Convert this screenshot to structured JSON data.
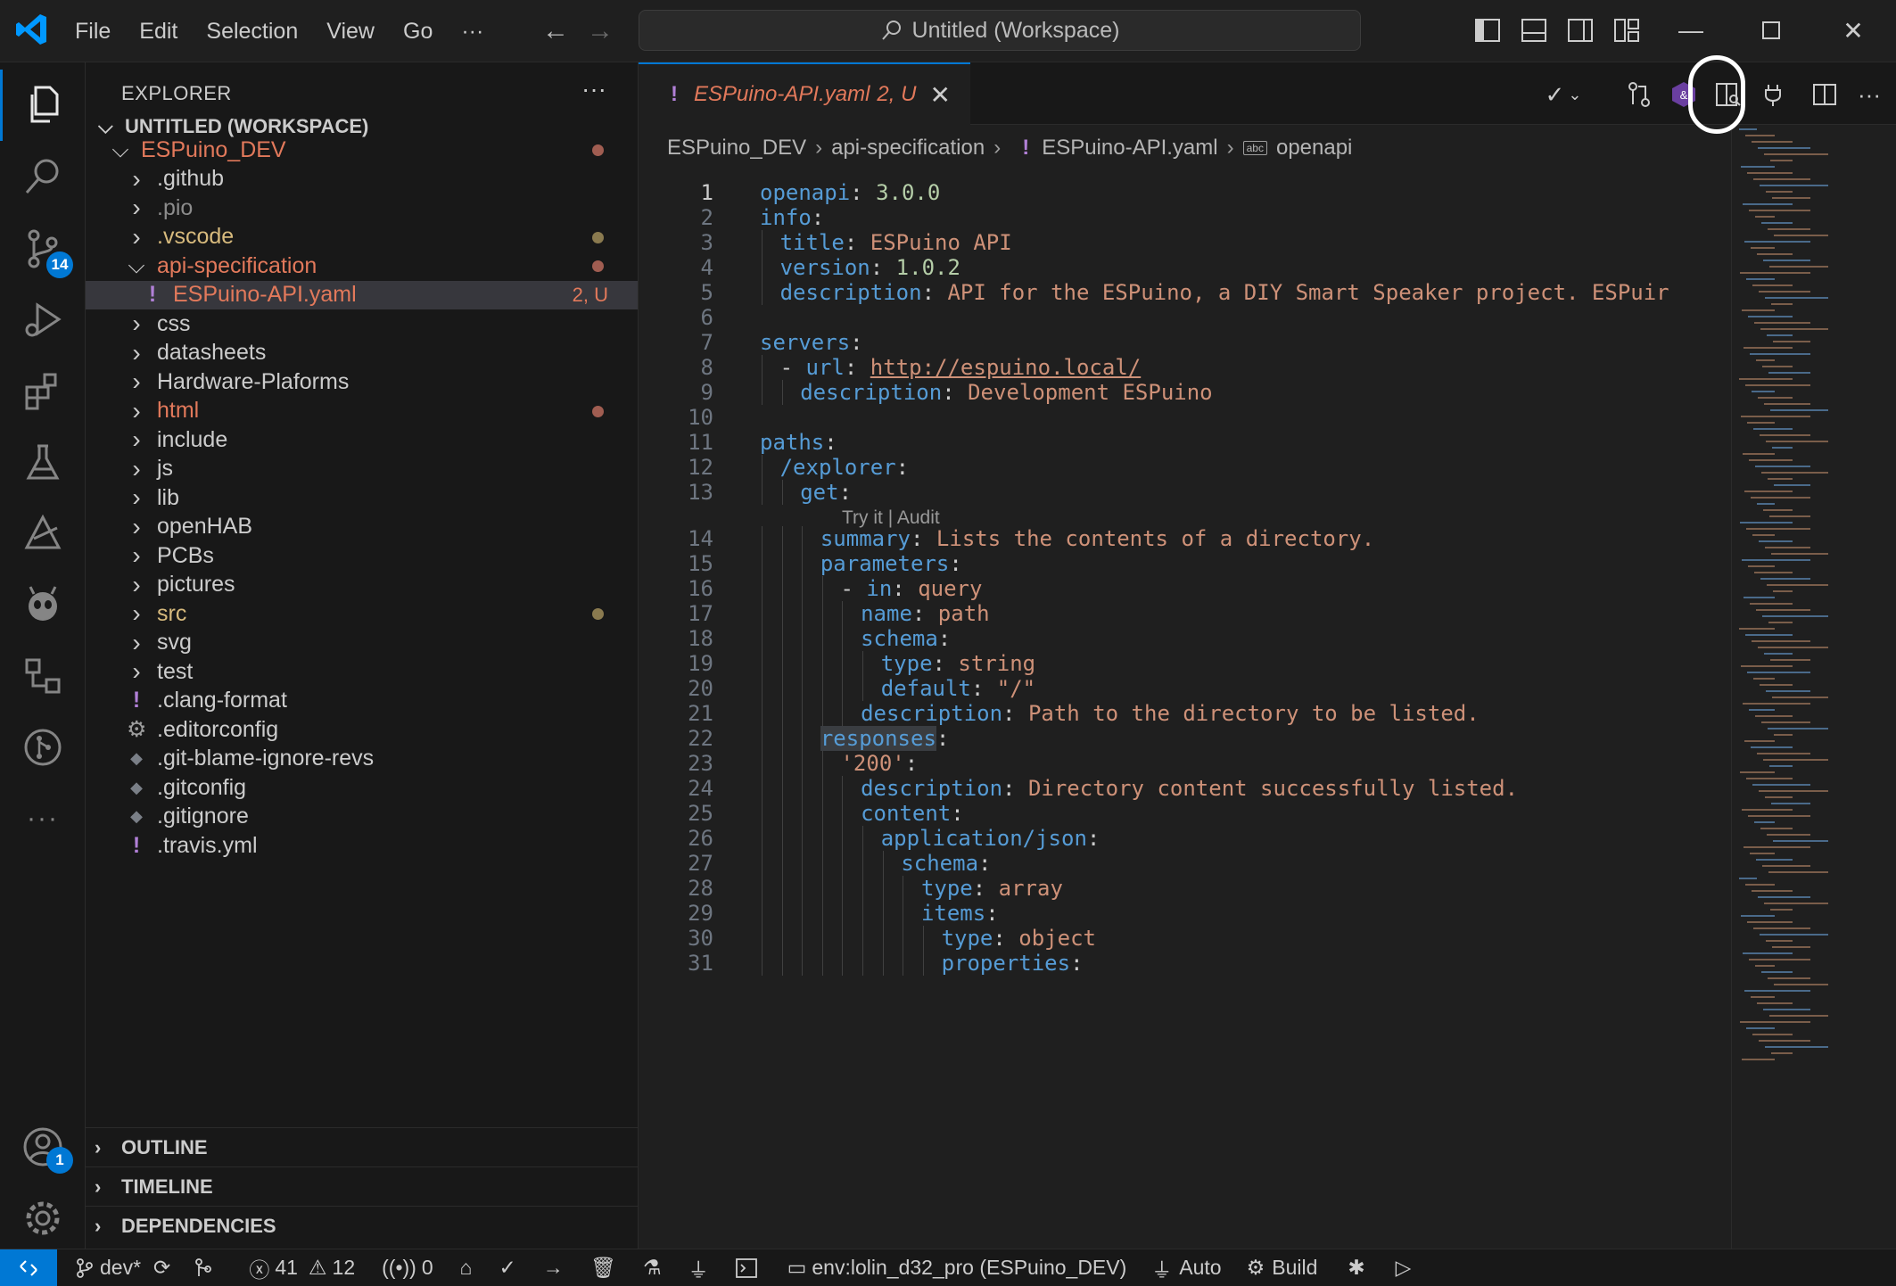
{
  "titlebar": {
    "menu": [
      "File",
      "Edit",
      "Selection",
      "View",
      "Go",
      "···"
    ],
    "search": "Untitled (Workspace)"
  },
  "activity": {
    "scm_badge": "14",
    "accounts_badge": "1"
  },
  "explorer": {
    "title": "EXPLORER",
    "workspace": "UNTITLED (WORKSPACE)",
    "items": [
      {
        "label": "ESPuino_DEV",
        "type": "folder-open",
        "color": "#e2795b",
        "dot": "#a05d51"
      },
      {
        "label": ".github",
        "type": "folder"
      },
      {
        "label": ".pio",
        "type": "folder",
        "color": "#8c8c8c"
      },
      {
        "label": ".vscode",
        "type": "folder",
        "color": "#d7ba7d",
        "dot": "#8a7a4f"
      },
      {
        "label": "api-specification",
        "type": "folder-open",
        "color": "#e2795b",
        "dot": "#a05d51"
      },
      {
        "label": "ESPuino-API.yaml",
        "type": "file-yaml",
        "color": "#e2795b",
        "status": "2, U"
      },
      {
        "label": "css",
        "type": "folder"
      },
      {
        "label": "datasheets",
        "type": "folder"
      },
      {
        "label": "Hardware-Plaforms",
        "type": "folder"
      },
      {
        "label": "html",
        "type": "folder",
        "color": "#e2795b",
        "dot": "#a05d51"
      },
      {
        "label": "include",
        "type": "folder"
      },
      {
        "label": "js",
        "type": "folder"
      },
      {
        "label": "lib",
        "type": "folder"
      },
      {
        "label": "openHAB",
        "type": "folder"
      },
      {
        "label": "PCBs",
        "type": "folder"
      },
      {
        "label": "pictures",
        "type": "folder"
      },
      {
        "label": "src",
        "type": "folder",
        "color": "#d7ba7d",
        "dot": "#8a7a4f"
      },
      {
        "label": "svg",
        "type": "folder"
      },
      {
        "label": "test",
        "type": "folder"
      },
      {
        "label": ".clang-format",
        "type": "file-bang"
      },
      {
        "label": ".editorconfig",
        "type": "file-gear"
      },
      {
        "label": ".git-blame-ignore-revs",
        "type": "file-git"
      },
      {
        "label": ".gitconfig",
        "type": "file-git"
      },
      {
        "label": ".gitignore",
        "type": "file-git"
      },
      {
        "label": ".travis.yml",
        "type": "file-bang"
      }
    ],
    "panels": [
      "OUTLINE",
      "TIMELINE",
      "DEPENDENCIES"
    ]
  },
  "tab": {
    "name": "ESPuino-API.yaml",
    "status": "2, U"
  },
  "breadcrumb": [
    "ESPuino_DEV",
    "api-specification",
    "ESPuino-API.yaml",
    "openapi"
  ],
  "codelens": "Try it | Audit",
  "code": [
    {
      "n": "1",
      "i": 0,
      "t": [
        [
          "k",
          "openapi"
        ],
        [
          "p",
          ": "
        ],
        [
          "n",
          "3.0.0"
        ]
      ]
    },
    {
      "n": "2",
      "i": 0,
      "t": [
        [
          "k",
          "info"
        ],
        [
          "p",
          ":"
        ]
      ]
    },
    {
      "n": "3",
      "i": 1,
      "t": [
        [
          "k",
          "title"
        ],
        [
          "p",
          ": "
        ],
        [
          "s",
          "ESPuino API"
        ]
      ]
    },
    {
      "n": "4",
      "i": 1,
      "t": [
        [
          "k",
          "version"
        ],
        [
          "p",
          ": "
        ],
        [
          "n",
          "1.0.2"
        ]
      ]
    },
    {
      "n": "5",
      "i": 1,
      "t": [
        [
          "k",
          "description"
        ],
        [
          "p",
          ": "
        ],
        [
          "s",
          "API for the ESPuino, a DIY Smart Speaker project. ESPuir"
        ]
      ]
    },
    {
      "n": "6",
      "i": 0,
      "t": []
    },
    {
      "n": "7",
      "i": 0,
      "t": [
        [
          "k",
          "servers"
        ],
        [
          "p",
          ":"
        ]
      ]
    },
    {
      "n": "8",
      "i": 1,
      "t": [
        [
          "p",
          "- "
        ],
        [
          "k",
          "url"
        ],
        [
          "p",
          ": "
        ],
        [
          "s",
          "http://espuino.local/"
        ]
      ]
    },
    {
      "n": "9",
      "i": 2,
      "t": [
        [
          "k",
          "description"
        ],
        [
          "p",
          ": "
        ],
        [
          "s",
          "Development ESPuino"
        ]
      ]
    },
    {
      "n": "10",
      "i": 0,
      "t": []
    },
    {
      "n": "11",
      "i": 0,
      "t": [
        [
          "k",
          "paths"
        ],
        [
          "p",
          ":"
        ]
      ]
    },
    {
      "n": "12",
      "i": 1,
      "t": [
        [
          "k",
          "/explorer"
        ],
        [
          "p",
          ":"
        ]
      ]
    },
    {
      "n": "13",
      "i": 2,
      "t": [
        [
          "k",
          "get"
        ],
        [
          "p",
          ":"
        ]
      ]
    },
    {
      "n": "14",
      "i": 3,
      "t": [
        [
          "k",
          "summary"
        ],
        [
          "p",
          ": "
        ],
        [
          "s",
          "Lists the contents of a directory."
        ]
      ]
    },
    {
      "n": "15",
      "i": 3,
      "t": [
        [
          "k",
          "parameters"
        ],
        [
          "p",
          ":"
        ]
      ]
    },
    {
      "n": "16",
      "i": 4,
      "t": [
        [
          "p",
          "- "
        ],
        [
          "k",
          "in"
        ],
        [
          "p",
          ": "
        ],
        [
          "s",
          "query"
        ]
      ]
    },
    {
      "n": "17",
      "i": 5,
      "t": [
        [
          "k",
          "name"
        ],
        [
          "p",
          ": "
        ],
        [
          "s",
          "path"
        ]
      ]
    },
    {
      "n": "18",
      "i": 5,
      "t": [
        [
          "k",
          "schema"
        ],
        [
          "p",
          ":"
        ]
      ]
    },
    {
      "n": "19",
      "i": 6,
      "t": [
        [
          "k",
          "type"
        ],
        [
          "p",
          ": "
        ],
        [
          "s",
          "string"
        ]
      ]
    },
    {
      "n": "20",
      "i": 6,
      "t": [
        [
          "k",
          "default"
        ],
        [
          "p",
          ": "
        ],
        [
          "s",
          "\"/\""
        ]
      ]
    },
    {
      "n": "21",
      "i": 5,
      "t": [
        [
          "k",
          "description"
        ],
        [
          "p",
          ": "
        ],
        [
          "s",
          "Path to the directory to be listed."
        ]
      ]
    },
    {
      "n": "22",
      "i": 3,
      "t": [
        [
          "k",
          "responses"
        ],
        [
          "p",
          ":"
        ]
      ],
      "hl": true
    },
    {
      "n": "23",
      "i": 4,
      "t": [
        [
          "s",
          "'200'"
        ],
        [
          "p",
          ":"
        ]
      ]
    },
    {
      "n": "24",
      "i": 5,
      "t": [
        [
          "k",
          "description"
        ],
        [
          "p",
          ": "
        ],
        [
          "s",
          "Directory content successfully listed."
        ]
      ]
    },
    {
      "n": "25",
      "i": 5,
      "t": [
        [
          "k",
          "content"
        ],
        [
          "p",
          ":"
        ]
      ]
    },
    {
      "n": "26",
      "i": 6,
      "t": [
        [
          "k",
          "application/json"
        ],
        [
          "p",
          ":"
        ]
      ]
    },
    {
      "n": "27",
      "i": 7,
      "t": [
        [
          "k",
          "schema"
        ],
        [
          "p",
          ":"
        ]
      ]
    },
    {
      "n": "28",
      "i": 8,
      "t": [
        [
          "k",
          "type"
        ],
        [
          "p",
          ": "
        ],
        [
          "s",
          "array"
        ]
      ]
    },
    {
      "n": "29",
      "i": 8,
      "t": [
        [
          "k",
          "items"
        ],
        [
          "p",
          ":"
        ]
      ]
    },
    {
      "n": "30",
      "i": 9,
      "t": [
        [
          "k",
          "type"
        ],
        [
          "p",
          ": "
        ],
        [
          "s",
          "object"
        ]
      ]
    },
    {
      "n": "31",
      "i": 9,
      "t": [
        [
          "k",
          "properties"
        ],
        [
          "p",
          ":"
        ]
      ]
    }
  ],
  "status": {
    "branch": "dev*",
    "errors": "41",
    "warnings": "12",
    "ports": "0",
    "env": "env:lolin_d32_pro (ESPuino_DEV)",
    "auto": "Auto",
    "build": "Build"
  }
}
